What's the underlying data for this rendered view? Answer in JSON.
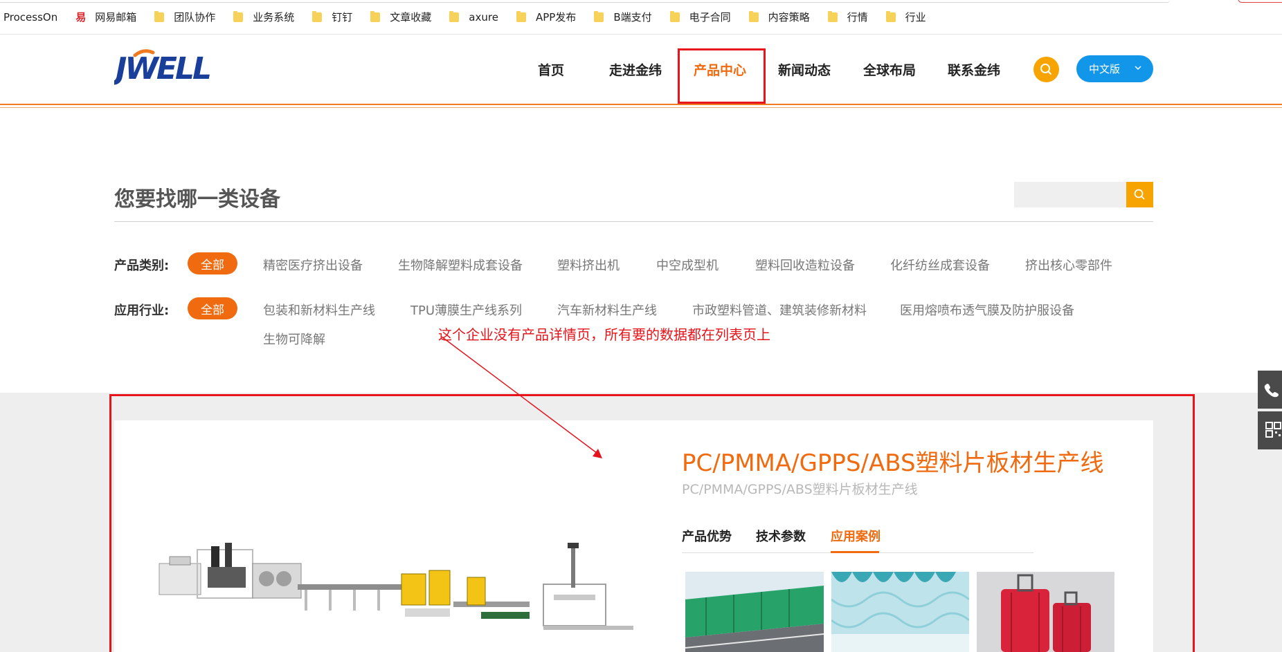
{
  "bookmarks": [
    {
      "label": "ProcessOn",
      "icon": "none"
    },
    {
      "label": "网易邮箱",
      "icon": "mail-icon"
    },
    {
      "label": "团队协作",
      "icon": "folder-icon"
    },
    {
      "label": "业务系统",
      "icon": "folder-icon"
    },
    {
      "label": "钉钉",
      "icon": "folder-icon"
    },
    {
      "label": "文章收藏",
      "icon": "folder-icon"
    },
    {
      "label": "axure",
      "icon": "folder-icon"
    },
    {
      "label": "APP发布",
      "icon": "folder-icon"
    },
    {
      "label": "B端支付",
      "icon": "folder-icon"
    },
    {
      "label": "电子合同",
      "icon": "folder-icon"
    },
    {
      "label": "内容策略",
      "icon": "folder-icon"
    },
    {
      "label": "行情",
      "icon": "folder-icon"
    },
    {
      "label": "行业",
      "icon": "folder-icon"
    }
  ],
  "header": {
    "logo_text": "JWELL",
    "nav": [
      "首页",
      "走进金纬",
      "产品中心",
      "新闻动态",
      "全球布局",
      "联系金纬"
    ],
    "active_nav": "产品中心",
    "lang_label": "中文版"
  },
  "filter": {
    "title": "您要找哪一类设备",
    "search_placeholder": "",
    "category_label": "产品类别:",
    "category_all": "全部",
    "categories": [
      "精密医疗挤出设备",
      "生物降解塑料成套设备",
      "塑料挤出机",
      "中空成型机",
      "塑料回收造粒设备",
      "化纤纺丝成套设备",
      "挤出核心零部件"
    ],
    "industry_label": "应用行业:",
    "industry_all": "全部",
    "industries": [
      "包装和新材料生产线",
      "TPU薄膜生产线系列",
      "汽车新材料生产线",
      "市政塑料管道、建筑装修新材料",
      "医用熔喷布透气膜及防护服设备",
      "生物可降解"
    ]
  },
  "annotation": "这个企业没有产品详情页，所有要的数据都在列表页上",
  "product": {
    "title": "PC/PMMA/GPPS/ABS塑料片板材生产线",
    "subtitle": "PC/PMMA/GPPS/ABS塑料片板材生产线",
    "tabs": [
      "产品优势",
      "技术参数",
      "应用案例"
    ],
    "active_tab": "应用案例"
  },
  "colors": {
    "brand_orange": "#f06a10",
    "search_yellow": "#f7a400",
    "lang_blue": "#1296ea",
    "annotation_red": "#e8141b",
    "logo_blue": "#1a3f9a"
  }
}
